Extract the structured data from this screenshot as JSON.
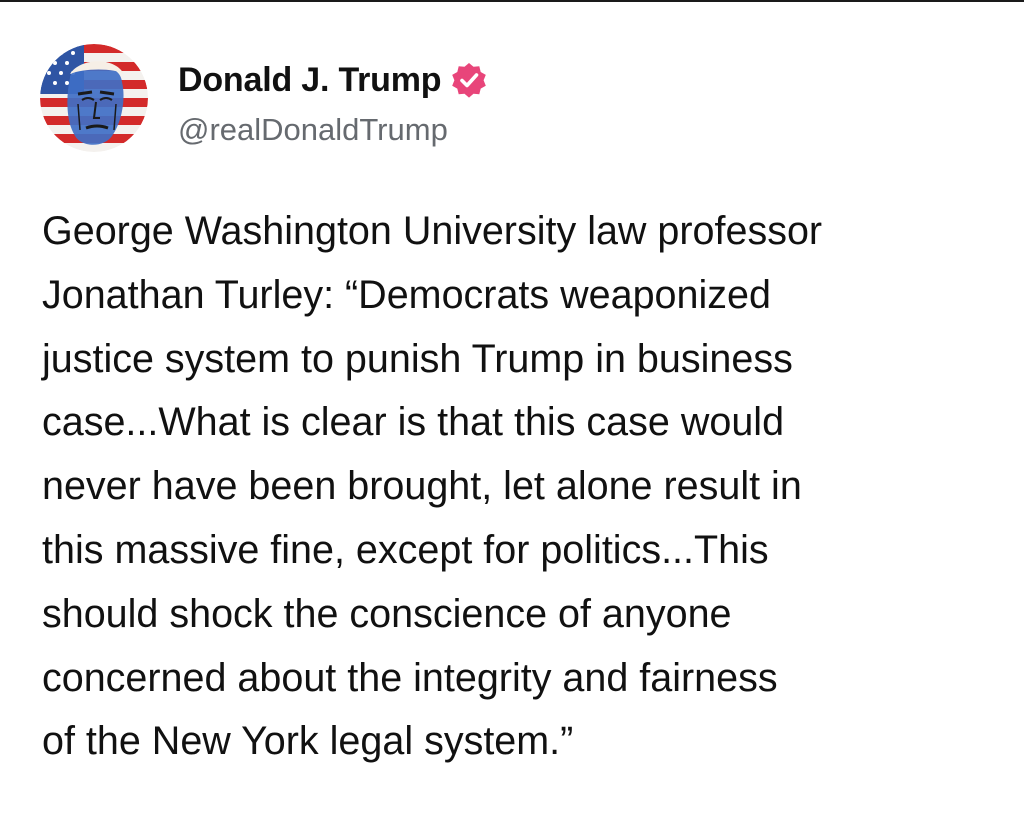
{
  "post": {
    "author": {
      "display_name": "Donald J. Trump",
      "handle": "@realDonaldTrump",
      "verified": true,
      "verified_badge_color": "#e8457a",
      "avatar_icon": "profile-avatar-flag-portrait"
    },
    "text": "George Washington University law professor\nJonathan Turley: “Democrats weaponized\njustice system to punish Trump in business\ncase...What is clear is that this case would\nnever have been brought, let alone result in\nthis massive fine, except for politics...This\nshould shock the conscience of anyone\nconcerned about the integrity and fairness\nof the New York legal system.”"
  }
}
